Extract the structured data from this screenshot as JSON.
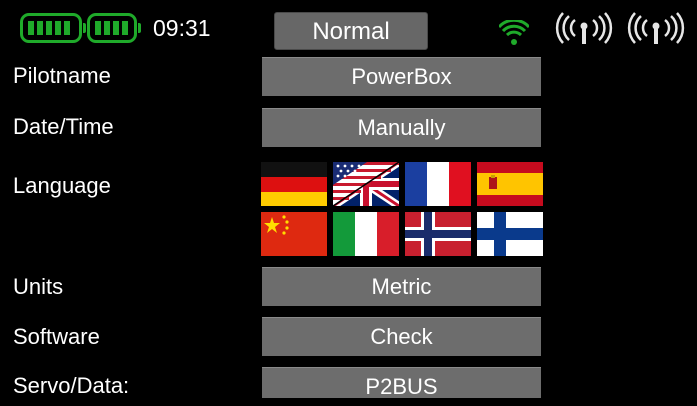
{
  "status_bar": {
    "battery_1_icon": "battery-icon",
    "battery_2_icon": "battery-icon",
    "time": "09:31",
    "mode": "Normal",
    "wifi_icon": "wifi-icon",
    "antenna_icons": [
      "antenna-icon",
      "antenna-icon"
    ],
    "accent_color": "#1faa2a"
  },
  "settings": {
    "pilotname": {
      "label": "Pilotname",
      "value": "PowerBox"
    },
    "datetime": {
      "label": "Date/Time",
      "value": "Manually"
    },
    "language": {
      "label": "Language",
      "flags": [
        "germany",
        "usa-uk",
        "france",
        "spain",
        "china",
        "italy",
        "norway",
        "finland"
      ]
    },
    "units": {
      "label": "Units",
      "value": "Metric"
    },
    "software": {
      "label": "Software",
      "value": "Check"
    },
    "servo_data": {
      "label": "Servo/Data:",
      "value": "P2BUS"
    }
  }
}
